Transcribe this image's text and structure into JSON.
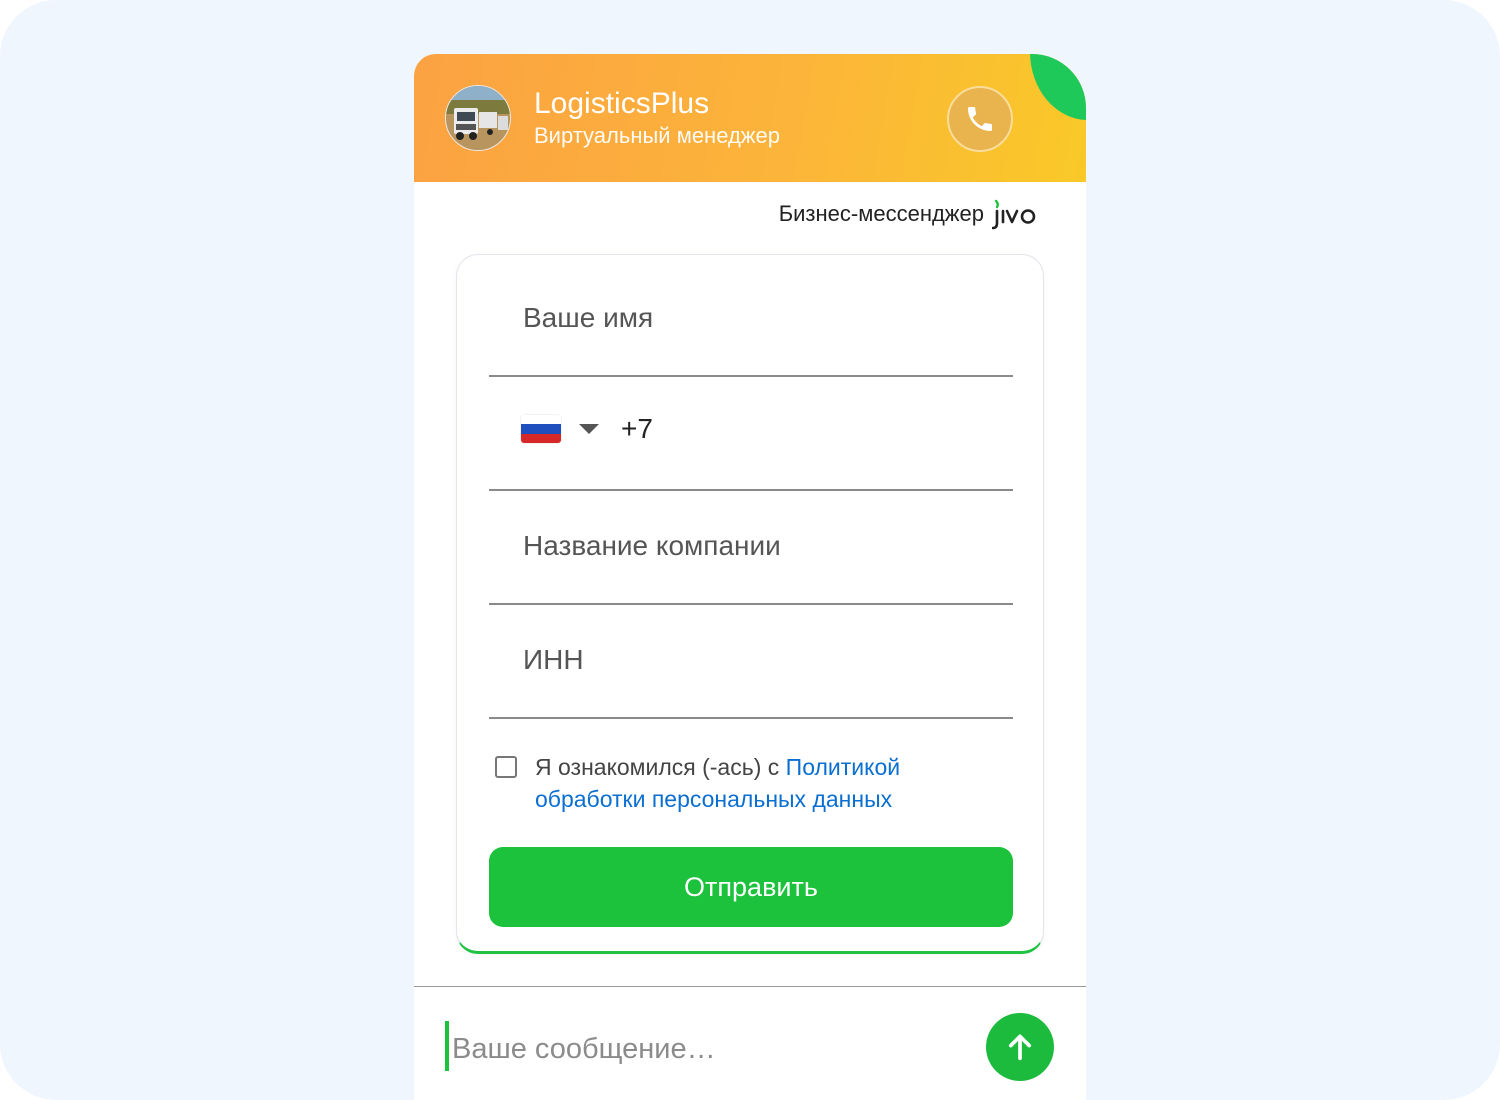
{
  "header": {
    "title": "LogisticsPlus",
    "subtitle": "Виртуальный менеджер",
    "avatar_icon": "truck-photo-avatar",
    "call_icon": "phone-icon"
  },
  "branding": {
    "text": "Бизнес-мессенджер",
    "logo": "jivo"
  },
  "form": {
    "name_placeholder": "Ваше имя",
    "phone": {
      "country_icon": "russia-flag-icon",
      "prefix": "+7"
    },
    "company_placeholder": "Название компании",
    "inn_placeholder": "ИНН",
    "consent": {
      "checked": false,
      "text": "Я ознакомился (-ась) с ",
      "link_text": "Политикой обработки персональных данных"
    },
    "submit_label": "Отправить"
  },
  "composer": {
    "placeholder": "Ваше сообщение…",
    "send_icon": "arrow-up-icon"
  },
  "colors": {
    "header_start": "#fba242",
    "header_end": "#f9c928",
    "accent_green": "#1cc23b",
    "link_blue": "#0b6fd1",
    "page_background": "#f0f6fd"
  }
}
